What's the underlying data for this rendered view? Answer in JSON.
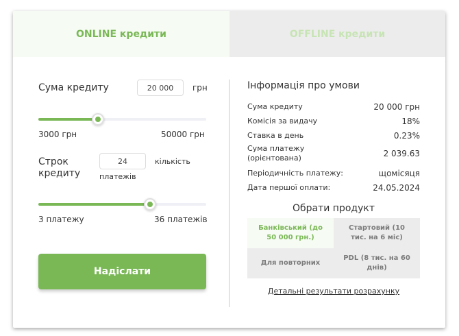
{
  "tabs": {
    "online": "ONLINE кредити",
    "offline": "OFFLINE кредити"
  },
  "loan": {
    "amount_label": "Сума кредиту",
    "amount_value": "20 000",
    "amount_unit": "грн",
    "amount_min": "3000 грн",
    "amount_max": "50000 грн",
    "amount_slider_fraction": 0.354,
    "term_label_line1": "Строк",
    "term_label_line2": "кредиту",
    "term_value": "24",
    "term_unit_line1": "кількість",
    "term_unit_line2": "платежів",
    "term_min": "3 платежу",
    "term_max": "36 платежів",
    "term_slider_fraction": 0.667,
    "submit_label": "Надіслати"
  },
  "info": {
    "title": "Інформація про умови",
    "rows": [
      {
        "k": "Сума кредиту",
        "v": "20 000 грн"
      },
      {
        "k": "Комісія за видачу",
        "v": "18%"
      },
      {
        "k": "Ставка в день",
        "v": "0.23%"
      },
      {
        "k1": "Сума платежу",
        "k2": "(орієнтована)",
        "v": "2 039.63"
      },
      {
        "k": "Періодичність платежу:",
        "v": "щомісяця"
      },
      {
        "k": "Дата першої оплати:",
        "v": "24.05.2024"
      }
    ]
  },
  "products": {
    "title": "Обрати продукт",
    "items": [
      {
        "label": "Банківський (до 50 000 грн.)"
      },
      {
        "label": "Стартовий (10 тис. на 6 міс)"
      },
      {
        "label": "Для повторних"
      },
      {
        "label": "PDL (8 тис. на 60 днів)"
      }
    ]
  },
  "details_link": "Детальні результати розрахунку",
  "colors": {
    "accent": "#7ab856",
    "inactive_bg": "#ececec",
    "active_bg": "#f6fbf3"
  }
}
